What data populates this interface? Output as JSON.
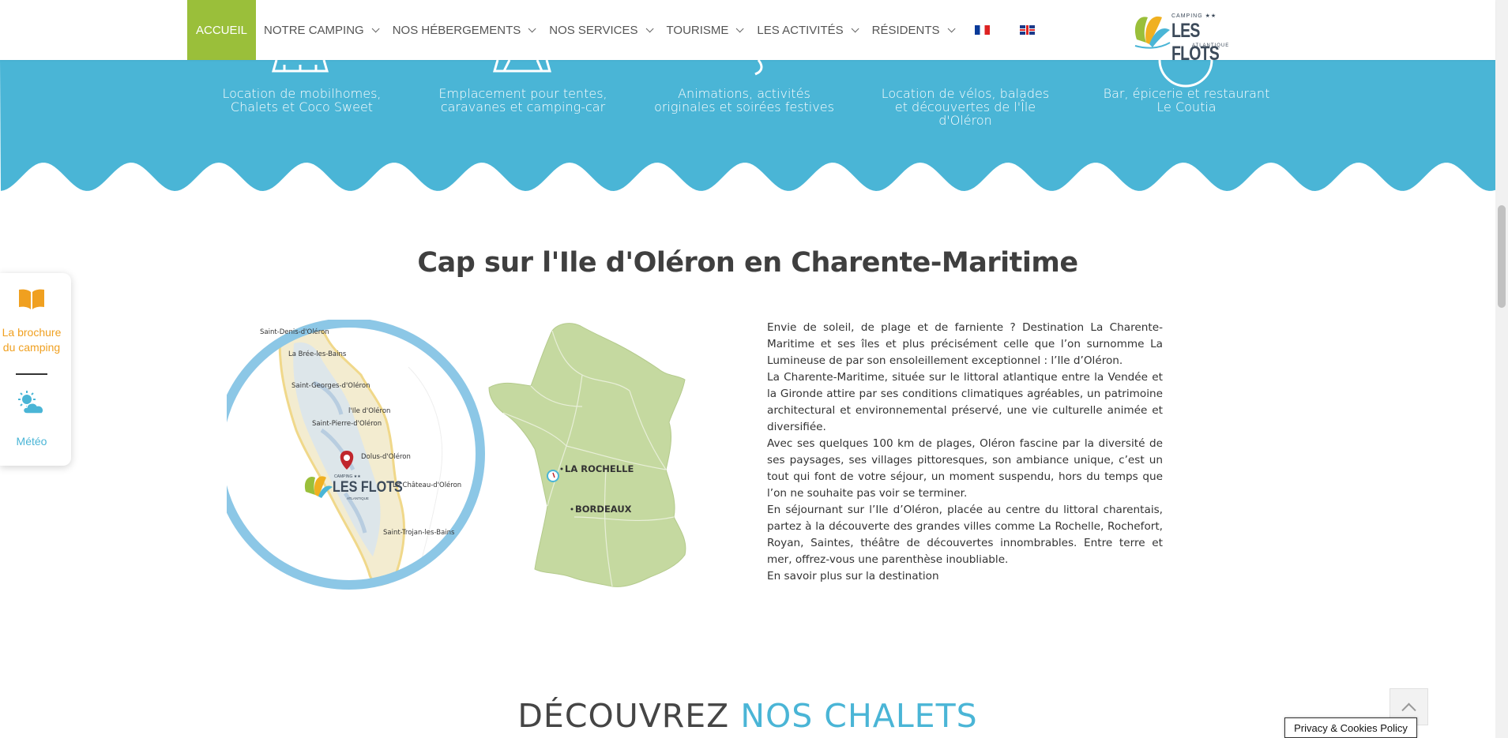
{
  "nav": {
    "items": [
      {
        "label": "ACCUEIL",
        "active": true,
        "dropdown": false
      },
      {
        "label": "NOTRE CAMPING",
        "active": false,
        "dropdown": true
      },
      {
        "label": "NOS HÉBERGEMENTS",
        "active": false,
        "dropdown": true
      },
      {
        "label": "NOS SERVICES",
        "active": false,
        "dropdown": true
      },
      {
        "label": "TOURISME",
        "active": false,
        "dropdown": true
      },
      {
        "label": "LES ACTIVITÉS",
        "active": false,
        "dropdown": true
      },
      {
        "label": "RÉSIDENTS",
        "active": false,
        "dropdown": true
      }
    ],
    "languages": [
      "fr-flag",
      "en-flag"
    ],
    "logo": {
      "small": "CAMPING ★★",
      "main": "LES FLOTS",
      "sub": "ATLANTIQUE"
    }
  },
  "colors": {
    "accent_green": "#9abf3a",
    "band_blue": "#4ab5d6",
    "map_green": "#c5d9a0",
    "brochure_orange": "#f0a020"
  },
  "services": [
    "Location de mobilhomes, Chalets et Coco Sweet",
    "Emplacement pour tentes, caravanes et camping-car",
    "Animations, activités originales et soirées festives",
    "Location de vélos, balades et découvertes de l'Île d'Oléron",
    "Bar, épicerie et restaurant Le Coutia"
  ],
  "section": {
    "title": "Cap sur l'Ile d'Oléron en Charente-Maritime",
    "paragraphs": [
      "Envie de soleil, de plage et de farniente ? Destination La Charente-Maritime et ses îles et plus précisément celle que l’on surnomme La Lumineuse de par son ensoleillement exceptionnel : l’Ile d’Oléron.",
      "La Charente-Maritime, située sur le littoral atlantique entre la Vendée et la Gironde attire par ses conditions climatiques agréables, un patrimoine architectural et environnemental préservé, une vie culturelle animée et diversifiée.",
      "Avec ses quelques 100 km de plages, Oléron fascine par la diversité de ses paysages, ses villages pittoresques, son ambiance unique, c’est un tout qui font de votre séjour, un moment suspendu, hors du temps que l’on ne souhaite pas voir se terminer.",
      "En séjournant sur l’Ile d’Oléron, placée au centre du littoral charentais, partez à la découverte des grandes villes comme La Rochelle, Rochefort, Royan, Saintes, théâtre de découvertes innombrables. Entre terre et mer, offrez-vous une parenthèse inoubliable."
    ],
    "more_link": "En savoir plus sur la destination"
  },
  "map": {
    "island_places": [
      "Saint-Denis-d'Oléron",
      "La Brée-les-Bains",
      "Saint-Georges-d'Oléron",
      "l'Ile d'Oléron",
      "Saint-Pierre-d'Oléron",
      "Dolus-d'Oléron",
      "Le Château-d'Oléron",
      "Saint-Trojan-les-Bains"
    ],
    "cities": [
      "LA ROCHELLE",
      "BORDEAUX"
    ],
    "map_logo": {
      "small": "CAMPING ★★",
      "main": "LES FLOTS",
      "sub": "ATLANTIQUE"
    }
  },
  "side_widget": {
    "brochure": "La brochure du camping",
    "weather": "Météo"
  },
  "bottom": {
    "title_part1": "DÉCOUVREZ",
    "title_part2": "NOS CHALETS"
  },
  "privacy": "Privacy & Cookies Policy"
}
